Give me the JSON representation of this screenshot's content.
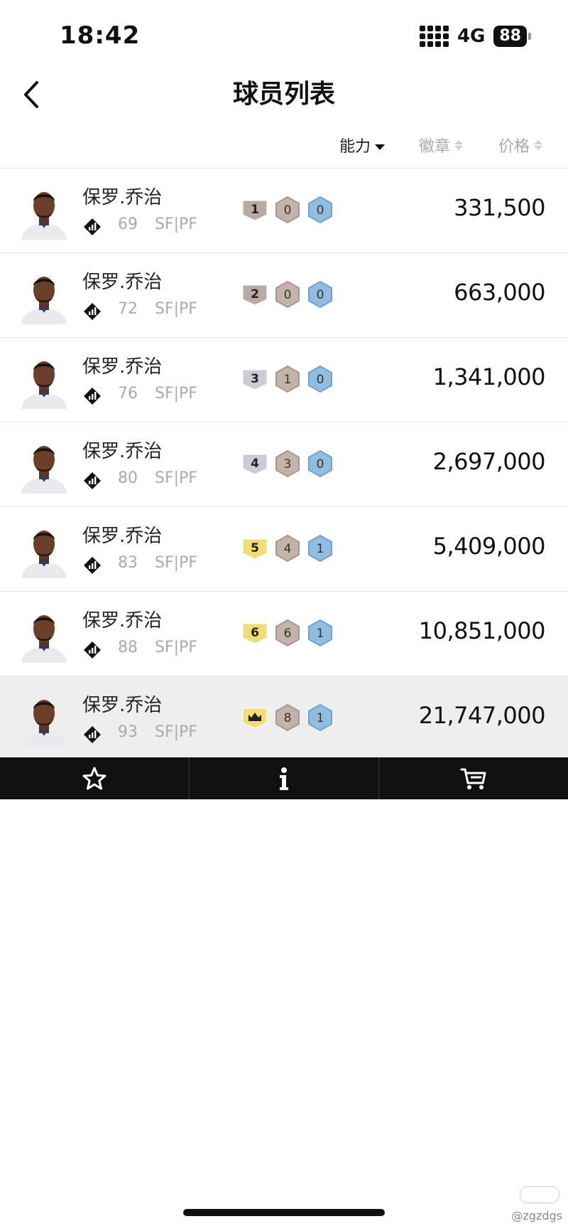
{
  "status_bar": {
    "time": "18:42",
    "network": "4G",
    "battery": "88"
  },
  "nav": {
    "title": "球员列表"
  },
  "sort": {
    "ability": "能力",
    "badge": "徽章",
    "price": "价格"
  },
  "players": [
    {
      "name": "保罗.乔治",
      "rating": "69",
      "position": "SF|PF",
      "level": "1",
      "level_color": "#b9aba3",
      "badge_a": "0",
      "badge_b": "0",
      "price": "331,500"
    },
    {
      "name": "保罗.乔治",
      "rating": "72",
      "position": "SF|PF",
      "level": "2",
      "level_color": "#b9aba3",
      "badge_a": "0",
      "badge_b": "0",
      "price": "663,000"
    },
    {
      "name": "保罗.乔治",
      "rating": "76",
      "position": "SF|PF",
      "level": "3",
      "level_color": "#c9cdd6",
      "badge_a": "1",
      "badge_b": "0",
      "price": "1,341,000"
    },
    {
      "name": "保罗.乔治",
      "rating": "80",
      "position": "SF|PF",
      "level": "4",
      "level_color": "#c9cdd6",
      "badge_a": "3",
      "badge_b": "0",
      "price": "2,697,000"
    },
    {
      "name": "保罗.乔治",
      "rating": "83",
      "position": "SF|PF",
      "level": "5",
      "level_color": "#f2dc78",
      "badge_a": "4",
      "badge_b": "1",
      "price": "5,409,000"
    },
    {
      "name": "保罗.乔治",
      "rating": "88",
      "position": "SF|PF",
      "level": "6",
      "level_color": "#f2dc78",
      "badge_a": "6",
      "badge_b": "1",
      "price": "10,851,000"
    },
    {
      "name": "保罗.乔治",
      "rating": "93",
      "position": "SF|PF",
      "level": "",
      "level_icon": "crown-icon",
      "level_color": "#f2dc78",
      "badge_a": "8",
      "badge_b": "1",
      "price": "21,747,000"
    }
  ],
  "tabs": [
    {
      "icon": "star-icon"
    },
    {
      "icon": "info-icon"
    },
    {
      "icon": "cart-icon"
    }
  ],
  "watermark": "@zgzdgs"
}
